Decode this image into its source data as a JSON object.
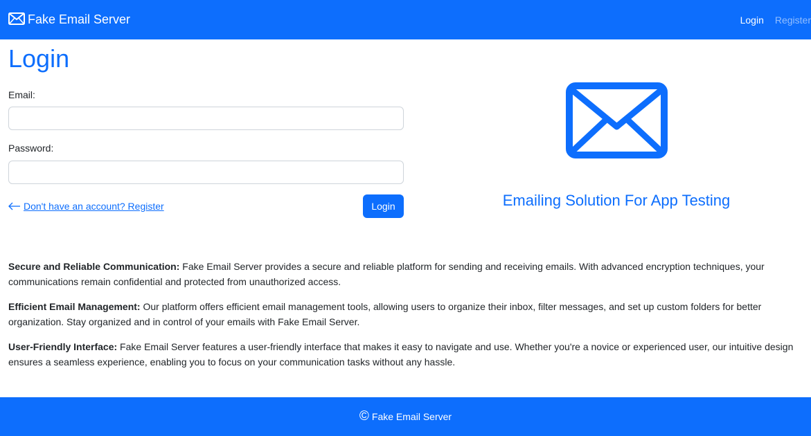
{
  "navbar": {
    "brand": "Fake Email Server",
    "brand_icon": "envelope-icon",
    "links": [
      {
        "label": "Login",
        "active": true
      },
      {
        "label": "Register",
        "active": false
      }
    ]
  },
  "login": {
    "title": "Login",
    "email_label": "Email:",
    "email_value": "",
    "password_label": "Password:",
    "password_value": "",
    "register_link": "Don't have an account? Register",
    "submit_label": "Login"
  },
  "hero": {
    "icon": "envelope-icon",
    "tagline": "Emailing Solution For App Testing"
  },
  "features": [
    {
      "title": "Secure and Reliable Communication:",
      "text": " Fake Email Server provides a secure and reliable platform for sending and receiving emails. With advanced encryption techniques, your communications remain confidential and protected from unauthorized access."
    },
    {
      "title": "Efficient Email Management:",
      "text": " Our platform offers efficient email management tools, allowing users to organize their inbox, filter messages, and set up custom folders for better organization. Stay organized and in control of your emails with Fake Email Server."
    },
    {
      "title": "User-Friendly Interface:",
      "text": " Fake Email Server features a user-friendly interface that makes it easy to navigate and use. Whether you're a novice or experienced user, our intuitive design ensures a seamless experience, enabling you to focus on your communication tasks without any hassle."
    }
  ],
  "footer": {
    "copyright_symbol": "©",
    "text": "Fake Email Server"
  },
  "colors": {
    "primary": "#0d6efd",
    "text": "#212529"
  }
}
